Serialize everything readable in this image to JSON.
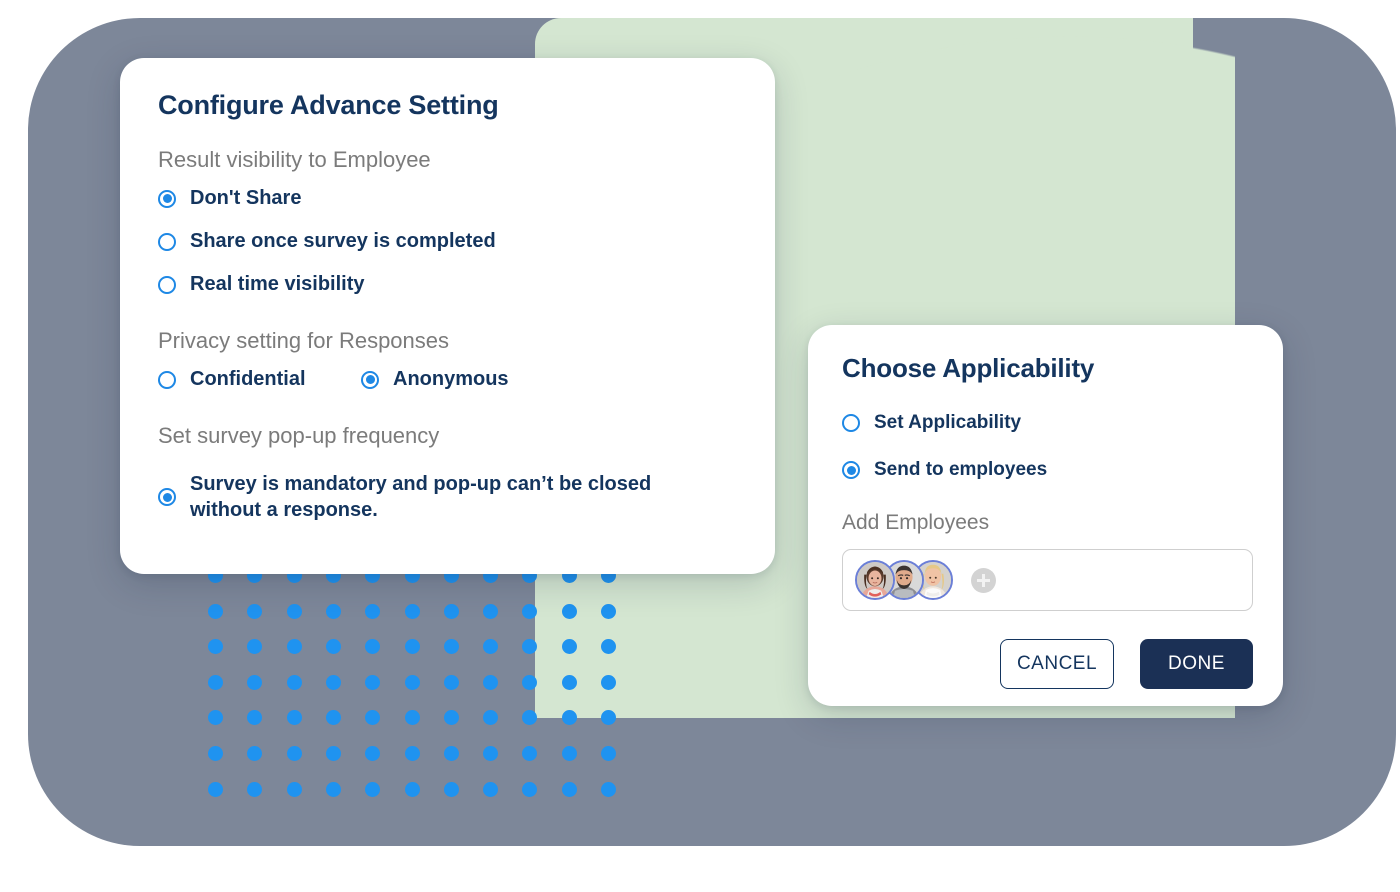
{
  "background": {
    "gray_shape_color": "#7d8799",
    "green_shape_color": "#d4e6d1",
    "dot_color": "#1f93f0",
    "dot_columns": 11,
    "dot_rows": 7
  },
  "theme": {
    "navy": "#14355e",
    "label_gray": "#7b7b7b",
    "radio_blue": "#1e88e5",
    "done_button_bg": "#1b3055",
    "avatar_ring": "#6b7fd7"
  },
  "advance_settings_card": {
    "title": "Configure Advance Setting",
    "sections": [
      {
        "label": "Result visibility to Employee",
        "options": [
          {
            "label": "Don't Share",
            "selected": true
          },
          {
            "label": "Share once survey is completed",
            "selected": false
          },
          {
            "label": "Real time visibility",
            "selected": false
          }
        ]
      },
      {
        "label": "Privacy setting for Responses",
        "options": [
          {
            "label": "Confidential",
            "selected": false
          },
          {
            "label": "Anonymous",
            "selected": true
          }
        ]
      },
      {
        "label": "Set survey pop-up frequency",
        "options": [
          {
            "label": "Survey is mandatory and pop-up can’t be closed without a response.",
            "selected": true
          }
        ]
      }
    ]
  },
  "applicability_card": {
    "title": "Choose Applicability",
    "options": [
      {
        "label": "Set Applicability",
        "selected": false
      },
      {
        "label": "Send to employees",
        "selected": true
      }
    ],
    "add_employees_label": "Add Employees",
    "employees": [
      {
        "name": "employee-avatar-1"
      },
      {
        "name": "employee-avatar-2"
      },
      {
        "name": "employee-avatar-3"
      }
    ],
    "add_employee_icon": "plus-icon",
    "buttons": {
      "cancel": "CANCEL",
      "done": "DONE"
    }
  }
}
